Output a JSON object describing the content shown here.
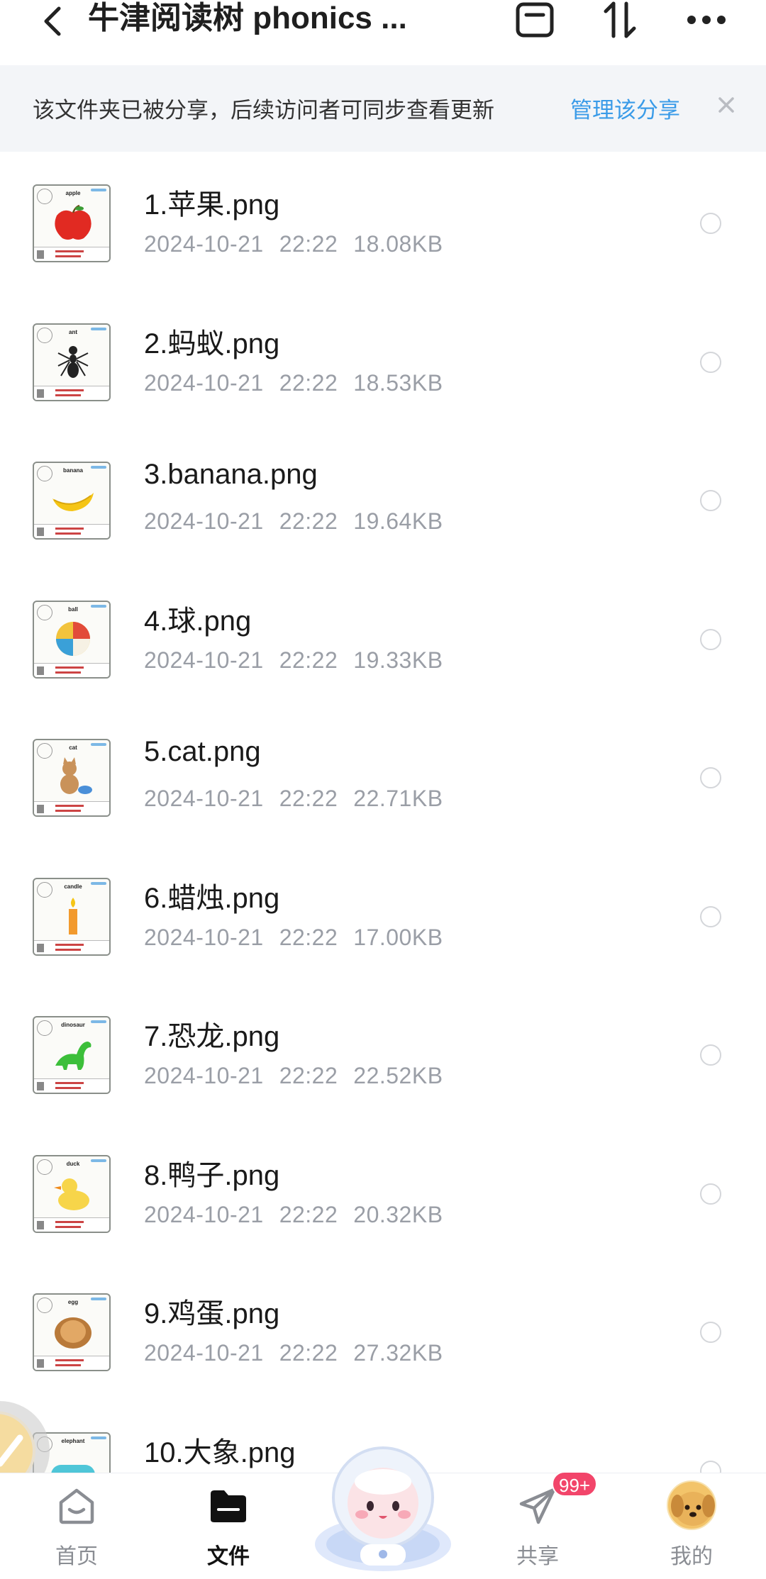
{
  "header": {
    "title": "牛津阅读树 phonics ..."
  },
  "banner": {
    "text": "该文件夹已被分享，后续访问者可同步查看更新",
    "link": "管理该分享"
  },
  "files": [
    {
      "name": "1.苹果.png",
      "date": "2024-10-21",
      "time": "22:22",
      "size": "18.08KB",
      "thumb_label": "apple",
      "pic": "apple"
    },
    {
      "name": "2.蚂蚁.png",
      "date": "2024-10-21",
      "time": "22:22",
      "size": "18.53KB",
      "thumb_label": "ant",
      "pic": "ant"
    },
    {
      "name": "3.banana.png",
      "date": "2024-10-21",
      "time": "22:22",
      "size": "19.64KB",
      "thumb_label": "banana",
      "pic": "banana"
    },
    {
      "name": "4.球.png",
      "date": "2024-10-21",
      "time": "22:22",
      "size": "19.33KB",
      "thumb_label": "ball",
      "pic": "ball"
    },
    {
      "name": "5.cat.png",
      "date": "2024-10-21",
      "time": "22:22",
      "size": "22.71KB",
      "thumb_label": "cat",
      "pic": "cat"
    },
    {
      "name": "6.蜡烛.png",
      "date": "2024-10-21",
      "time": "22:22",
      "size": "17.00KB",
      "thumb_label": "candle",
      "pic": "candle"
    },
    {
      "name": "7.恐龙.png",
      "date": "2024-10-21",
      "time": "22:22",
      "size": "22.52KB",
      "thumb_label": "dinosaur",
      "pic": "dinosaur"
    },
    {
      "name": "8.鸭子.png",
      "date": "2024-10-21",
      "time": "22:22",
      "size": "20.32KB",
      "thumb_label": "duck",
      "pic": "duck"
    },
    {
      "name": "9.鸡蛋.png",
      "date": "2024-10-21",
      "time": "22:22",
      "size": "27.32KB",
      "thumb_label": "egg",
      "pic": "egg"
    },
    {
      "name": "10.大象.png",
      "date": "",
      "time": "",
      "size": "",
      "thumb_label": "elephant",
      "pic": "elephant"
    }
  ],
  "tabs": {
    "home": "首页",
    "files": "文件",
    "share": "共享",
    "mine": "我的"
  },
  "share_badge": "99+",
  "colors": {
    "accent_link": "#3a9be8",
    "badge": "#f2456a",
    "banner_bg": "#f3f5f8"
  }
}
